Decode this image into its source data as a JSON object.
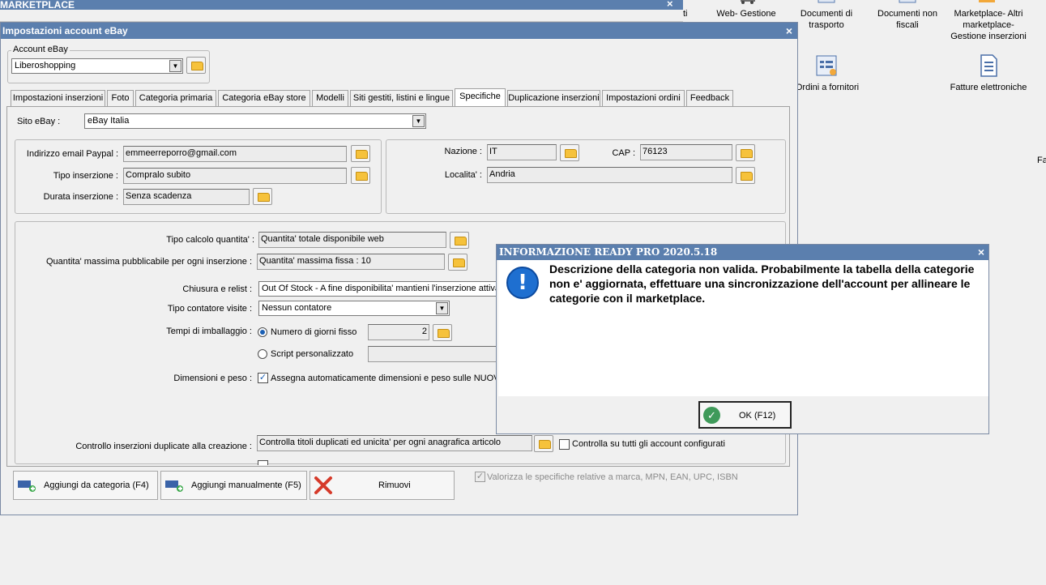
{
  "background_window": {
    "title": "MARKETPLACE",
    "close": "×"
  },
  "desktop": {
    "partial_letter_left": "ti",
    "partial_letter_right": "Fa",
    "icons": [
      {
        "label": "Web- Gestione",
        "icon": "web-icon"
      },
      {
        "label": "Documenti di trasporto",
        "icon": "document-icon"
      },
      {
        "label": "Documenti non fiscali",
        "icon": "document-icon"
      },
      {
        "label": "Marketplace- Altri marketplace- Gestione inserzioni",
        "icon": "marketplace-icon"
      },
      {
        "label": "Ordini a fornitori",
        "icon": "orders-icon"
      },
      {
        "label": "Fatture elettroniche",
        "icon": "invoice-icon"
      }
    ]
  },
  "window": {
    "title": "Impostazioni account eBay",
    "close": "×",
    "account_group_label": "Account eBay",
    "account_value": "Liberoshopping",
    "tabs": [
      "Impostazioni inserzioni",
      "Foto",
      "Categoria primaria",
      "Categoria eBay store",
      "Modelli",
      "Siti gestiti, listini e lingue",
      "Specifiche",
      "Duplicazione inserzioni",
      "Impostazioni ordini",
      "Feedback"
    ],
    "active_tab": "Specifiche"
  },
  "form": {
    "sito_label": "Sito eBay :",
    "sito_value": "eBay Italia",
    "email_label": "Indirizzo email Paypal :",
    "email_value": "emmeerreporro@gmail.com",
    "tipo_inserzione_label": "Tipo inserzione :",
    "tipo_inserzione_value": "Compralo subito",
    "durata_label": "Durata inserzione :",
    "durata_value": "Senza scadenza",
    "nazione_label": "Nazione :",
    "nazione_value": "IT",
    "cap_label": "CAP :",
    "cap_value": "76123",
    "localita_label": "Localita' :",
    "localita_value": "Andria",
    "tipo_calcolo_label": "Tipo calcolo quantita' :",
    "tipo_calcolo_value": "Quantita' totale disponibile web",
    "qta_massima_label": "Quantita' massima pubblicabile per ogni inserzione :",
    "qta_massima_value": "Quantita' massima fissa : 10",
    "chiusura_label": "Chiusura e relist :",
    "chiusura_value": "Out Of Stock - A fine disponibilita' mantieni l'inserzione attiva",
    "contatore_label": "Tipo contatore visite :",
    "contatore_value": "Nessun contatore",
    "imballaggio_label": "Tempi di imballaggio :",
    "radio_giorni": "Numero di giorni fisso",
    "giorni_value": "2",
    "radio_script": "Script personalizzato",
    "dimensioni_label": "Dimensioni e peso :",
    "dimensioni_check": "Assegna automaticamente dimensioni e peso sulle NUOVE i",
    "controllo_label": "Controllo inserzioni duplicate alla creazione :",
    "controllo_value": "Controlla titoli duplicati ed unicita' per ogni anagrafica articolo",
    "controllo_tutti": "Controlla su tutti gli account configurati"
  },
  "buttons": {
    "aggiungi_categoria": "Aggiungi da categoria (F4)",
    "aggiungi_manuale": "Aggiungi manualmente (F5)",
    "rimuovi": "Rimuovi",
    "valorizza": "Valorizza le specifiche relative a marca, MPN, EAN, UPC, ISBN"
  },
  "dialog": {
    "title": "INFORMAZIONE READY PRO 2020.5.18",
    "close": "×",
    "icon_glyph": "!",
    "message": "Descrizione della categoria non valida. Probabilmente la tabella della categorie non e' aggiornata, effettuare una sincronizzazione dell'account per allineare le categorie con il marketplace.",
    "ok_label": "OK (F12)",
    "ok_glyph": "✓"
  },
  "colors": {
    "titlebar": "#5b7fae",
    "info_icon": "#1e6fd0",
    "ok_icon": "#3f9a5a",
    "remove_icon": "#d63a2a"
  }
}
